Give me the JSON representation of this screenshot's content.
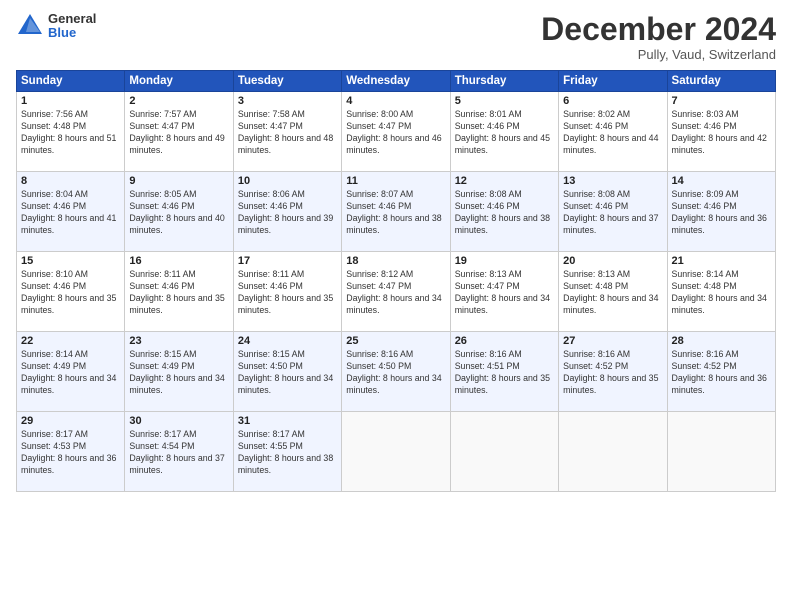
{
  "logo": {
    "general": "General",
    "blue": "Blue"
  },
  "header": {
    "month": "December 2024",
    "location": "Pully, Vaud, Switzerland"
  },
  "weekdays": [
    "Sunday",
    "Monday",
    "Tuesday",
    "Wednesday",
    "Thursday",
    "Friday",
    "Saturday"
  ],
  "weeks": [
    [
      {
        "day": "1",
        "sunrise": "7:56 AM",
        "sunset": "4:48 PM",
        "daylight": "8 hours and 51 minutes."
      },
      {
        "day": "2",
        "sunrise": "7:57 AM",
        "sunset": "4:47 PM",
        "daylight": "8 hours and 49 minutes."
      },
      {
        "day": "3",
        "sunrise": "7:58 AM",
        "sunset": "4:47 PM",
        "daylight": "8 hours and 48 minutes."
      },
      {
        "day": "4",
        "sunrise": "8:00 AM",
        "sunset": "4:47 PM",
        "daylight": "8 hours and 46 minutes."
      },
      {
        "day": "5",
        "sunrise": "8:01 AM",
        "sunset": "4:46 PM",
        "daylight": "8 hours and 45 minutes."
      },
      {
        "day": "6",
        "sunrise": "8:02 AM",
        "sunset": "4:46 PM",
        "daylight": "8 hours and 44 minutes."
      },
      {
        "day": "7",
        "sunrise": "8:03 AM",
        "sunset": "4:46 PM",
        "daylight": "8 hours and 42 minutes."
      }
    ],
    [
      {
        "day": "8",
        "sunrise": "8:04 AM",
        "sunset": "4:46 PM",
        "daylight": "8 hours and 41 minutes."
      },
      {
        "day": "9",
        "sunrise": "8:05 AM",
        "sunset": "4:46 PM",
        "daylight": "8 hours and 40 minutes."
      },
      {
        "day": "10",
        "sunrise": "8:06 AM",
        "sunset": "4:46 PM",
        "daylight": "8 hours and 39 minutes."
      },
      {
        "day": "11",
        "sunrise": "8:07 AM",
        "sunset": "4:46 PM",
        "daylight": "8 hours and 38 minutes."
      },
      {
        "day": "12",
        "sunrise": "8:08 AM",
        "sunset": "4:46 PM",
        "daylight": "8 hours and 38 minutes."
      },
      {
        "day": "13",
        "sunrise": "8:08 AM",
        "sunset": "4:46 PM",
        "daylight": "8 hours and 37 minutes."
      },
      {
        "day": "14",
        "sunrise": "8:09 AM",
        "sunset": "4:46 PM",
        "daylight": "8 hours and 36 minutes."
      }
    ],
    [
      {
        "day": "15",
        "sunrise": "8:10 AM",
        "sunset": "4:46 PM",
        "daylight": "8 hours and 35 minutes."
      },
      {
        "day": "16",
        "sunrise": "8:11 AM",
        "sunset": "4:46 PM",
        "daylight": "8 hours and 35 minutes."
      },
      {
        "day": "17",
        "sunrise": "8:11 AM",
        "sunset": "4:46 PM",
        "daylight": "8 hours and 35 minutes."
      },
      {
        "day": "18",
        "sunrise": "8:12 AM",
        "sunset": "4:47 PM",
        "daylight": "8 hours and 34 minutes."
      },
      {
        "day": "19",
        "sunrise": "8:13 AM",
        "sunset": "4:47 PM",
        "daylight": "8 hours and 34 minutes."
      },
      {
        "day": "20",
        "sunrise": "8:13 AM",
        "sunset": "4:48 PM",
        "daylight": "8 hours and 34 minutes."
      },
      {
        "day": "21",
        "sunrise": "8:14 AM",
        "sunset": "4:48 PM",
        "daylight": "8 hours and 34 minutes."
      }
    ],
    [
      {
        "day": "22",
        "sunrise": "8:14 AM",
        "sunset": "4:49 PM",
        "daylight": "8 hours and 34 minutes."
      },
      {
        "day": "23",
        "sunrise": "8:15 AM",
        "sunset": "4:49 PM",
        "daylight": "8 hours and 34 minutes."
      },
      {
        "day": "24",
        "sunrise": "8:15 AM",
        "sunset": "4:50 PM",
        "daylight": "8 hours and 34 minutes."
      },
      {
        "day": "25",
        "sunrise": "8:16 AM",
        "sunset": "4:50 PM",
        "daylight": "8 hours and 34 minutes."
      },
      {
        "day": "26",
        "sunrise": "8:16 AM",
        "sunset": "4:51 PM",
        "daylight": "8 hours and 35 minutes."
      },
      {
        "day": "27",
        "sunrise": "8:16 AM",
        "sunset": "4:52 PM",
        "daylight": "8 hours and 35 minutes."
      },
      {
        "day": "28",
        "sunrise": "8:16 AM",
        "sunset": "4:52 PM",
        "daylight": "8 hours and 36 minutes."
      }
    ],
    [
      {
        "day": "29",
        "sunrise": "8:17 AM",
        "sunset": "4:53 PM",
        "daylight": "8 hours and 36 minutes."
      },
      {
        "day": "30",
        "sunrise": "8:17 AM",
        "sunset": "4:54 PM",
        "daylight": "8 hours and 37 minutes."
      },
      {
        "day": "31",
        "sunrise": "8:17 AM",
        "sunset": "4:55 PM",
        "daylight": "8 hours and 38 minutes."
      },
      null,
      null,
      null,
      null
    ]
  ]
}
